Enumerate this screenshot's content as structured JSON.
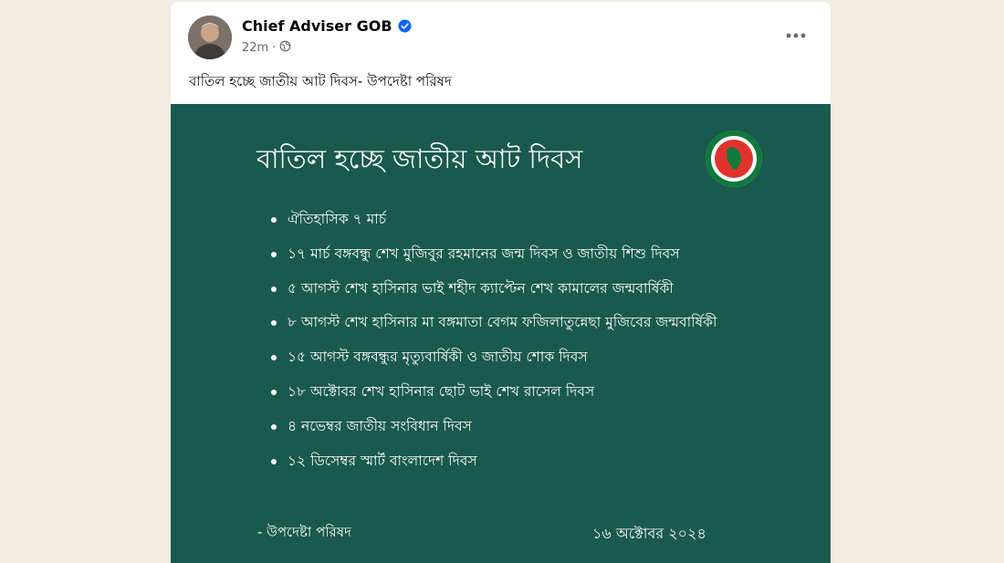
{
  "post": {
    "page_name": "Chief Adviser GOB",
    "time": "22m",
    "separator": "·",
    "audience_icon": "globe-icon",
    "more_icon": "more-options-icon",
    "caption": "বাতিল হচ্ছে জাতীয় আট দিবস- উপদেষ্টা পরিষদ"
  },
  "graphic": {
    "title": "বাতিল হচ্ছে জাতীয় আট দিবস",
    "items": [
      "ঐতিহাসিক ৭ মার্চ",
      "১৭ মার্চ বঙ্গবন্ধু শেখ মুজিবুর রহমানের জন্ম দিবস ও জাতীয় শিশু দিবস",
      "৫ আগস্ট শেখ হাসিনার ভাই শহীদ ক্যাপ্টেন শেখ কামালের জন্মবার্ষিকী",
      "৮ আগস্ট শেখ হাসিনার মা বঙ্গমাতা বেগম ফজিলাতুন্নেছা মুজিবের জন্মবার্ষিকী",
      "১৫ আগস্ট বঙ্গবন্ধুর মৃত্যুবার্ষিকী ও জাতীয় শোক দিবস",
      "১৮ অক্টোবর শেখ হাসিনার ছোট ভাই শেখ রাসেল দিবস",
      "৪ নভেম্বর জাতীয় সংবিধান দিবস",
      "১২ ডিসেম্বর স্মার্ট বাংলাদেশ দিবস"
    ],
    "signature": "- উপদেষ্টা পরিষদ",
    "date": "১৬ অক্টোবর ২০২৪"
  },
  "colors": {
    "graphic_background": "#1a5a4e",
    "verified_badge": "#0866ff",
    "seal_red": "#e0322a",
    "seal_green": "#0f7a3a"
  }
}
